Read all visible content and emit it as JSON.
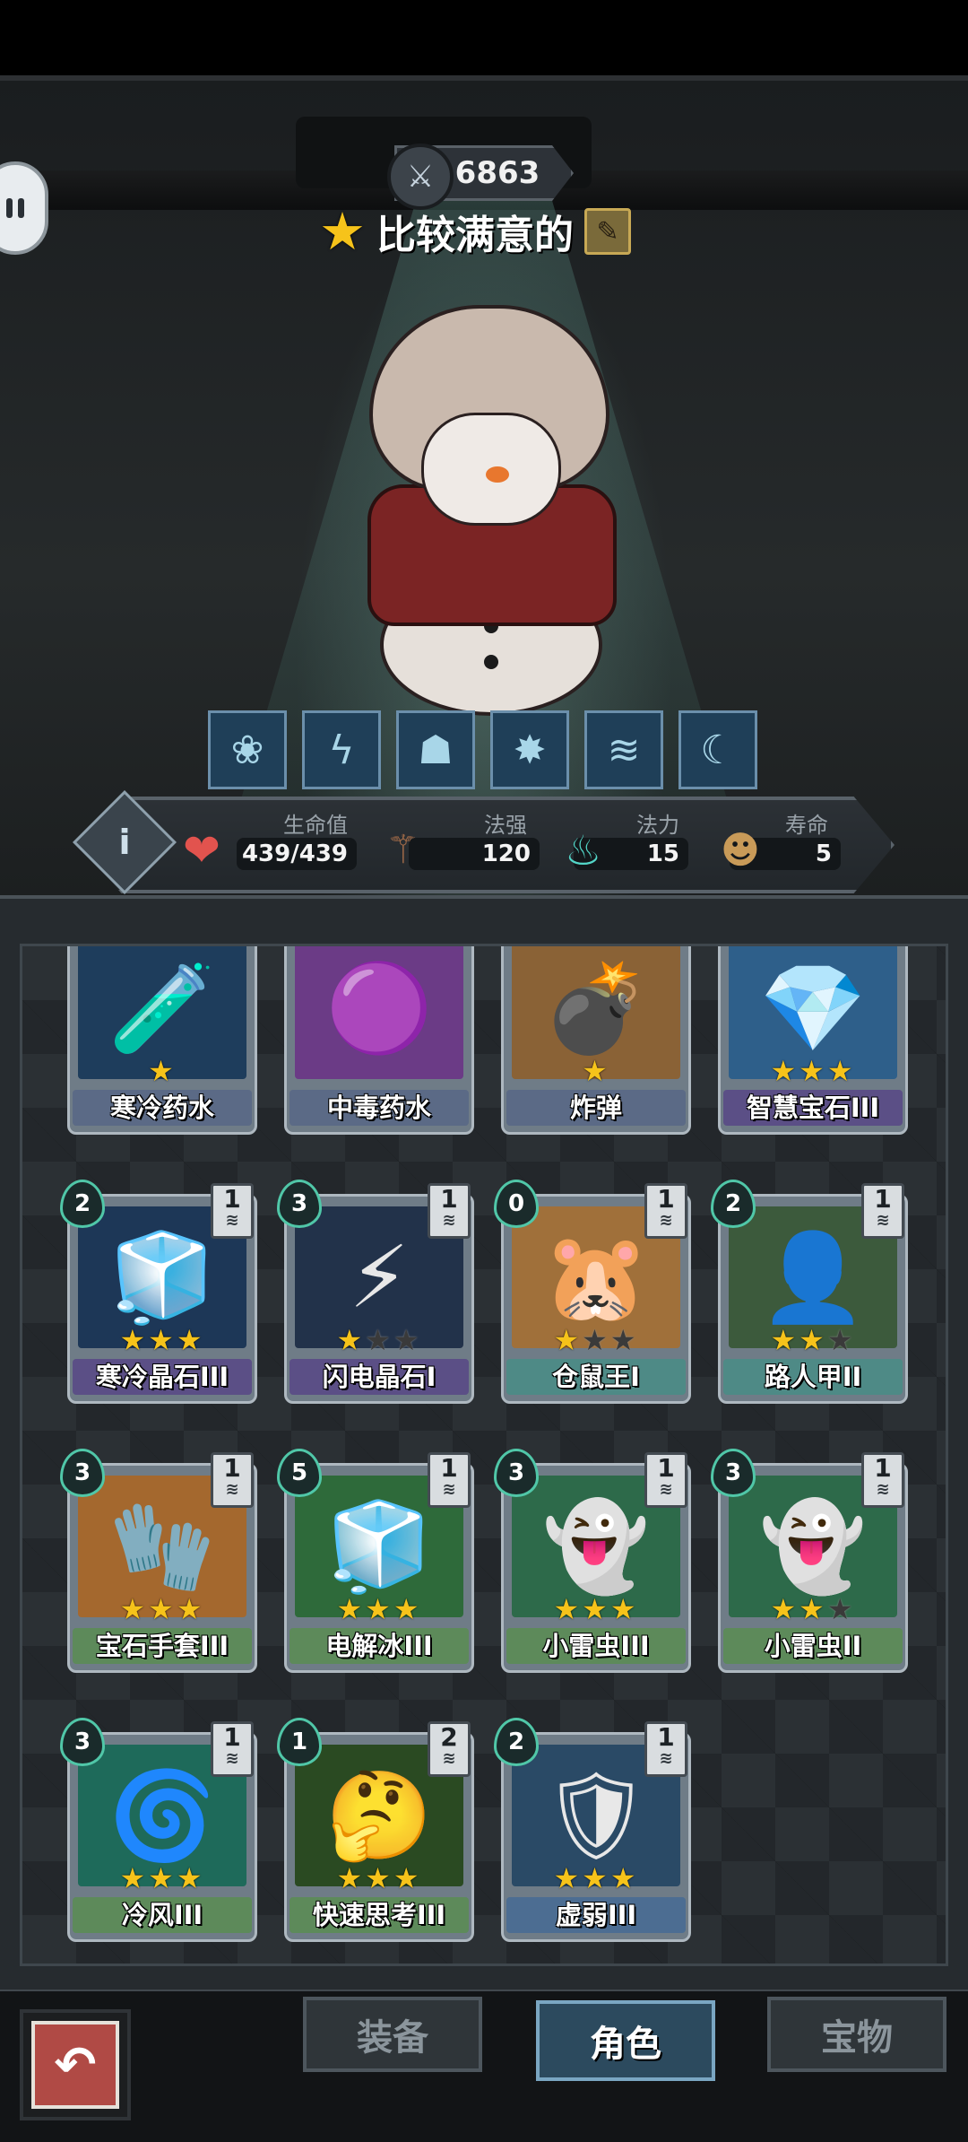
{
  "header": {
    "score": "6863",
    "score_icon": "rune-icon",
    "mood": "比较满意的",
    "mood_icon": "star-icon",
    "edit_icon": "edit-icon"
  },
  "skills": [
    "rose-icon",
    "crack-icon",
    "ghost-icon",
    "burst-icon",
    "claw-icon",
    "moon-heart-icon"
  ],
  "stats": {
    "hp": {
      "label": "生命值",
      "value": "439/439"
    },
    "power": {
      "label": "法强",
      "value": "120"
    },
    "mana": {
      "label": "法力",
      "value": "15"
    },
    "life": {
      "label": "寿命",
      "value": "5"
    }
  },
  "cards": [
    {
      "name": "寒冷药水",
      "stars": 1,
      "max_stars": 1,
      "cost": "",
      "level": "",
      "art": "🧪",
      "art_bg": "#1e3d5c",
      "name_bg": "#5b6a86"
    },
    {
      "name": "中毒药水",
      "stars": 0,
      "max_stars": 0,
      "cost": "",
      "level": "",
      "art": "🟣",
      "art_bg": "#6b3b86",
      "name_bg": "#5b6a86"
    },
    {
      "name": "炸弹",
      "stars": 1,
      "max_stars": 1,
      "cost": "",
      "level": "",
      "art": "💣",
      "art_bg": "#8a6236",
      "name_bg": "#5b6a86"
    },
    {
      "name": "智慧宝石III",
      "stars": 3,
      "max_stars": 3,
      "cost": "",
      "level": "",
      "art": "💎",
      "art_bg": "#2e5f8a",
      "name_bg": "#5b4f86"
    },
    {
      "name": "寒冷晶石III",
      "stars": 3,
      "max_stars": 3,
      "cost": "2",
      "level": "1",
      "art": "🧊",
      "art_bg": "#1d3757",
      "name_bg": "#5b4f86"
    },
    {
      "name": "闪电晶石I",
      "stars": 1,
      "max_stars": 3,
      "cost": "3",
      "level": "1",
      "art": "⚡",
      "art_bg": "#22324a",
      "name_bg": "#5b4f86"
    },
    {
      "name": "仓鼠王I",
      "stars": 1,
      "max_stars": 3,
      "cost": "0",
      "level": "1",
      "art": "🐹",
      "art_bg": "#a0703a",
      "name_bg": "#4e8a86"
    },
    {
      "name": "路人甲II",
      "stars": 2,
      "max_stars": 3,
      "cost": "2",
      "level": "1",
      "art": "👤",
      "art_bg": "#3c5a3c",
      "name_bg": "#4e8a86"
    },
    {
      "name": "宝石手套III",
      "stars": 3,
      "max_stars": 3,
      "cost": "3",
      "level": "1",
      "art": "🧤",
      "art_bg": "#a4682e",
      "name_bg": "#5d8a5a"
    },
    {
      "name": "电解冰III",
      "stars": 3,
      "max_stars": 3,
      "cost": "5",
      "level": "1",
      "art": "🧊",
      "art_bg": "#2e6a3a",
      "name_bg": "#5d8a5a"
    },
    {
      "name": "小雷虫III",
      "stars": 3,
      "max_stars": 3,
      "cost": "3",
      "level": "1",
      "art": "👻",
      "art_bg": "#2d6a4a",
      "name_bg": "#5d8a5a"
    },
    {
      "name": "小雷虫II",
      "stars": 2,
      "max_stars": 3,
      "cost": "3",
      "level": "1",
      "art": "👻",
      "art_bg": "#2d6a4a",
      "name_bg": "#5d8a5a"
    },
    {
      "name": "冷风III",
      "stars": 3,
      "max_stars": 3,
      "cost": "3",
      "level": "1",
      "art": "🌀",
      "art_bg": "#1e6a5a",
      "name_bg": "#5d8a5a"
    },
    {
      "name": "快速思考III",
      "stars": 3,
      "max_stars": 3,
      "cost": "1",
      "level": "2",
      "art": "🤔",
      "art_bg": "#2a4a22",
      "name_bg": "#5d8a5a"
    },
    {
      "name": "虚弱III",
      "stars": 3,
      "max_stars": 3,
      "cost": "2",
      "level": "1",
      "art": "🛡",
      "art_bg": "#2a4a66",
      "name_bg": "#4c6d92"
    }
  ],
  "nav": {
    "back_icon": "back-arrow-icon",
    "tabs": [
      {
        "label": "装备",
        "active": false
      },
      {
        "label": "角色",
        "active": true
      },
      {
        "label": "宝物",
        "active": false
      }
    ]
  },
  "colors": {
    "star": "#f6c31a",
    "accent": "#50c7a8",
    "back_button": "#b04a45"
  }
}
